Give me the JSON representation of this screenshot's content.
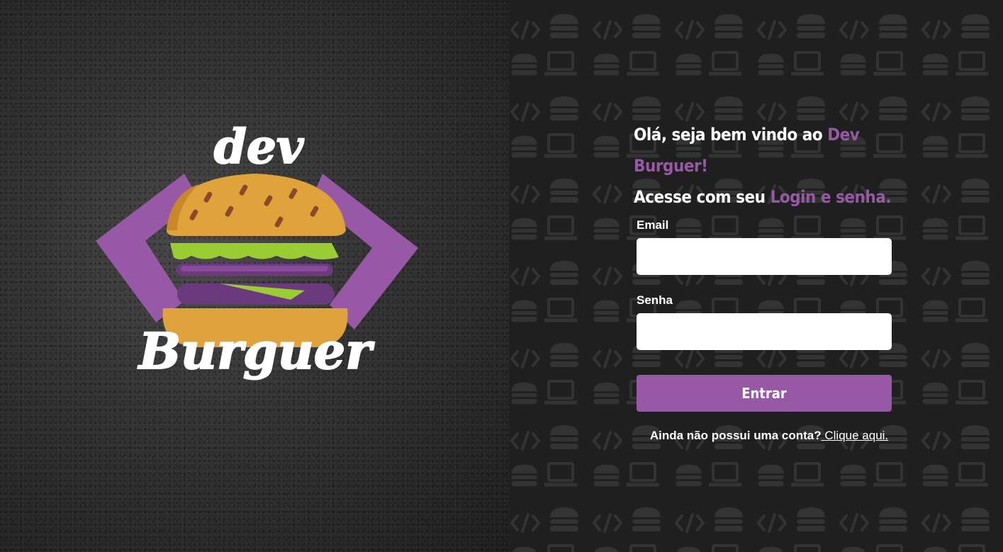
{
  "brand": {
    "logo_top_word": "dev",
    "logo_bottom_word": "Burguer",
    "colors": {
      "purple": "#9758a6",
      "bun": "#e0a23a",
      "lettuce": "#9acd32",
      "patty": "#6b3a7d",
      "dark_bg": "#1f1f1f"
    }
  },
  "greeting": {
    "line1_prefix": "Olá, seja bem vindo ao ",
    "line1_highlight": "Dev Burguer!",
    "line2_prefix": "Acesse com seu ",
    "line2_highlight": "Login e senha."
  },
  "form": {
    "email_label": "Email",
    "email_value": "",
    "password_label": "Senha",
    "password_value": "",
    "submit_label": "Entrar"
  },
  "signup": {
    "prompt": "Ainda não possui uma conta?",
    "link_label": " Clique aqui."
  },
  "background_pattern": {
    "icons": [
      "code-brackets-icon",
      "burger-icon",
      "laptop-icon"
    ]
  }
}
